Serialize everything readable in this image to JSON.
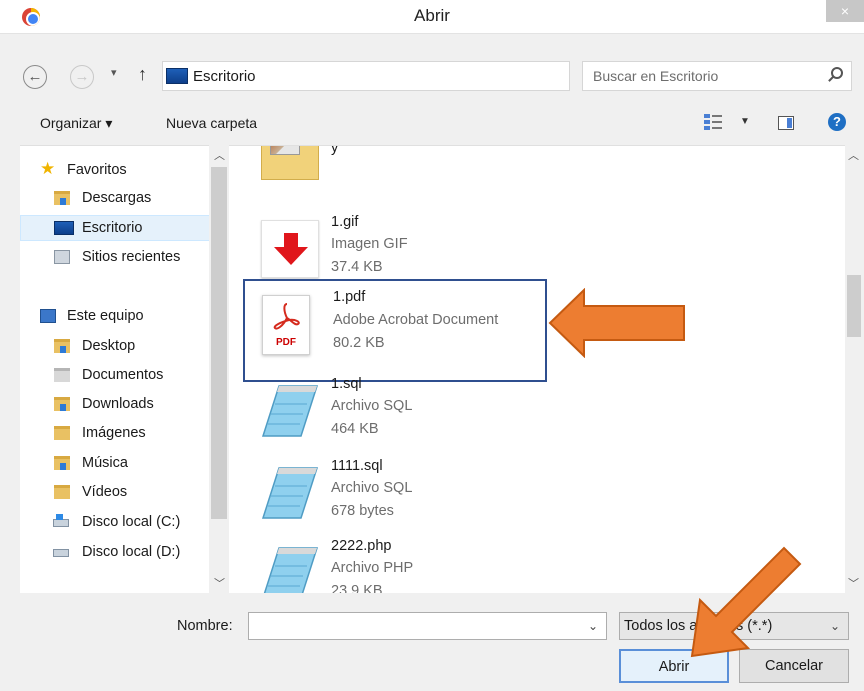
{
  "window": {
    "title": "Abrir",
    "close_glyph": "×"
  },
  "address": {
    "path": "Escritorio",
    "search_placeholder": "Buscar en Escritorio"
  },
  "toolbar": {
    "organize": "Organizar ▾",
    "new_folder": "Nueva carpeta",
    "help": "?"
  },
  "nav": {
    "items": [
      {
        "label": "Favoritos",
        "icon": "star-icon"
      },
      {
        "label": "Descargas",
        "icon": "downloads-folder-icon"
      },
      {
        "label": "Escritorio",
        "icon": "desktop-icon",
        "selected": true
      },
      {
        "label": "Sitios recientes",
        "icon": "recent-places-icon"
      },
      {
        "label": "Este equipo",
        "icon": "computer-icon"
      },
      {
        "label": "Desktop",
        "icon": "folder-icon"
      },
      {
        "label": "Documentos",
        "icon": "documents-folder-icon"
      },
      {
        "label": "Downloads",
        "icon": "downloads-folder-icon"
      },
      {
        "label": "Imágenes",
        "icon": "pictures-folder-icon"
      },
      {
        "label": "Música",
        "icon": "music-folder-icon"
      },
      {
        "label": "Vídeos",
        "icon": "videos-folder-icon"
      },
      {
        "label": "Disco local (C:)",
        "icon": "windows-drive-icon"
      },
      {
        "label": "Disco local (D:)",
        "icon": "drive-icon"
      }
    ]
  },
  "files": [
    {
      "name": "y",
      "type": "",
      "size": "",
      "icon": "folder-thumbnail-icon"
    },
    {
      "name": "1.gif",
      "type": "Imagen GIF",
      "size": "37.4 KB",
      "icon": "gif-down-arrow-icon"
    },
    {
      "name": "1.pdf",
      "type": "Adobe Acrobat Document",
      "size": "80.2 KB",
      "icon": "pdf-icon",
      "pdf_label": "PDF",
      "highlighted": true
    },
    {
      "name": "1.sql",
      "type": "Archivo SQL",
      "size": "464 KB",
      "icon": "notepad-icon"
    },
    {
      "name": "1111.sql",
      "type": "Archivo SQL",
      "size": "678 bytes",
      "icon": "notepad-icon"
    },
    {
      "name": "2222.php",
      "type": "Archivo PHP",
      "size": "23.9 KB",
      "icon": "notepad-icon"
    }
  ],
  "bottom": {
    "name_label": "Nombre:",
    "name_value": "",
    "file_type": "Todos los archivos (*.*)",
    "open_button": "Abrir",
    "cancel_button": "Cancelar"
  },
  "colors": {
    "annotation_arrow": "#ed7d31",
    "highlight_border": "#2f4f8f",
    "selected_nav": "#e5f1fb"
  }
}
